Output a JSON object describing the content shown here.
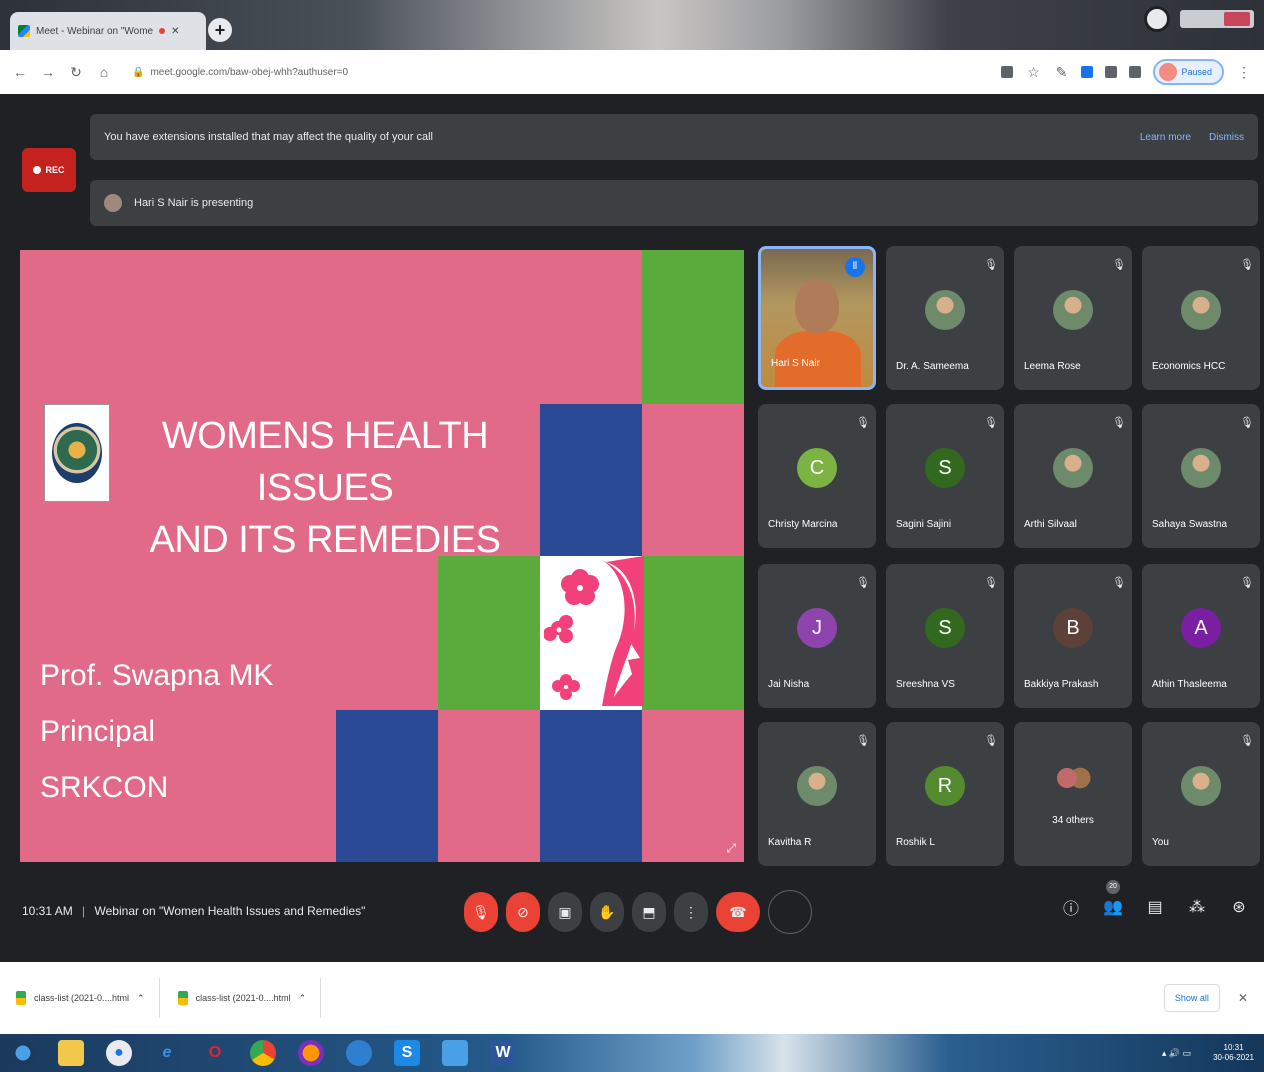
{
  "browser": {
    "tab_title": "Meet - Webinar on \"Wome",
    "url": "meet.google.com/baw-obej-whh?authuser=0",
    "profile_label": "Paused"
  },
  "meet": {
    "rec_label": "REC",
    "extension_notice": "You have extensions installed that may affect the quality of your call",
    "learn_more": "Learn more",
    "dismiss": "Dismiss",
    "presenting_text": "Hari S Nair is presenting",
    "time": "10:31 AM",
    "separator": "|",
    "meeting_title": "Webinar on \"Women Health Issues and Remedies\"",
    "participant_count": "20"
  },
  "slide": {
    "title_line1": "WOMENS HEALTH ISSUES",
    "title_line2": "AND ITS REMEDIES",
    "presenter_name": "Prof. Swapna MK",
    "presenter_role": "Principal",
    "presenter_org": "SRKCON",
    "colors": {
      "pink": "#e06a88",
      "green": "#5aaa3c",
      "blue": "#2a4a96"
    }
  },
  "participants": [
    {
      "name": "Hari S Nair",
      "avatar": "photo",
      "speaking": true
    },
    {
      "name": "Dr. A. Sameema",
      "avatar": "photo"
    },
    {
      "name": "Leema Rose",
      "avatar": "photo"
    },
    {
      "name": "Economics HCC",
      "avatar": "photo"
    },
    {
      "name": "Christy Marcina",
      "avatar": "C",
      "color": "#7cb342"
    },
    {
      "name": "Sagini Sajini",
      "avatar": "S",
      "color": "#33691e"
    },
    {
      "name": "Arthi Silvaal",
      "avatar": "photo"
    },
    {
      "name": "Sahaya Swastna",
      "avatar": "photo"
    },
    {
      "name": "Jai Nisha",
      "avatar": "J",
      "color": "#8e44ad"
    },
    {
      "name": "Sreeshna VS",
      "avatar": "S",
      "color": "#33691e"
    },
    {
      "name": "Bakkiya Prakash",
      "avatar": "B",
      "color": "#5d4037"
    },
    {
      "name": "Athin Thasleema",
      "avatar": "A",
      "color": "#7b1fa2"
    },
    {
      "name": "Kavitha R",
      "avatar": "photo"
    },
    {
      "name": "Roshik L",
      "avatar": "R",
      "color": "#558b2f"
    },
    {
      "name": "34 others",
      "avatar": "group"
    },
    {
      "name": "You",
      "avatar": "photo"
    }
  ],
  "downloads": {
    "items": [
      "class-list (2021-0....html",
      "class-list (2021-0....html"
    ],
    "show_all": "Show all"
  },
  "taskbar": {
    "time": "10:31",
    "date": "30-06-2021"
  },
  "icons": {
    "mic_off": "mic-off-icon",
    "cam_off": "videocam-off-icon",
    "captions": "captions-icon",
    "hand": "raise-hand-icon",
    "present": "present-icon",
    "more": "more-vert-icon",
    "end_call": "call-end-icon",
    "info": "info-icon",
    "people": "people-icon",
    "chat": "chat-icon",
    "activities": "activities-icon",
    "lock": "lock-icon"
  }
}
